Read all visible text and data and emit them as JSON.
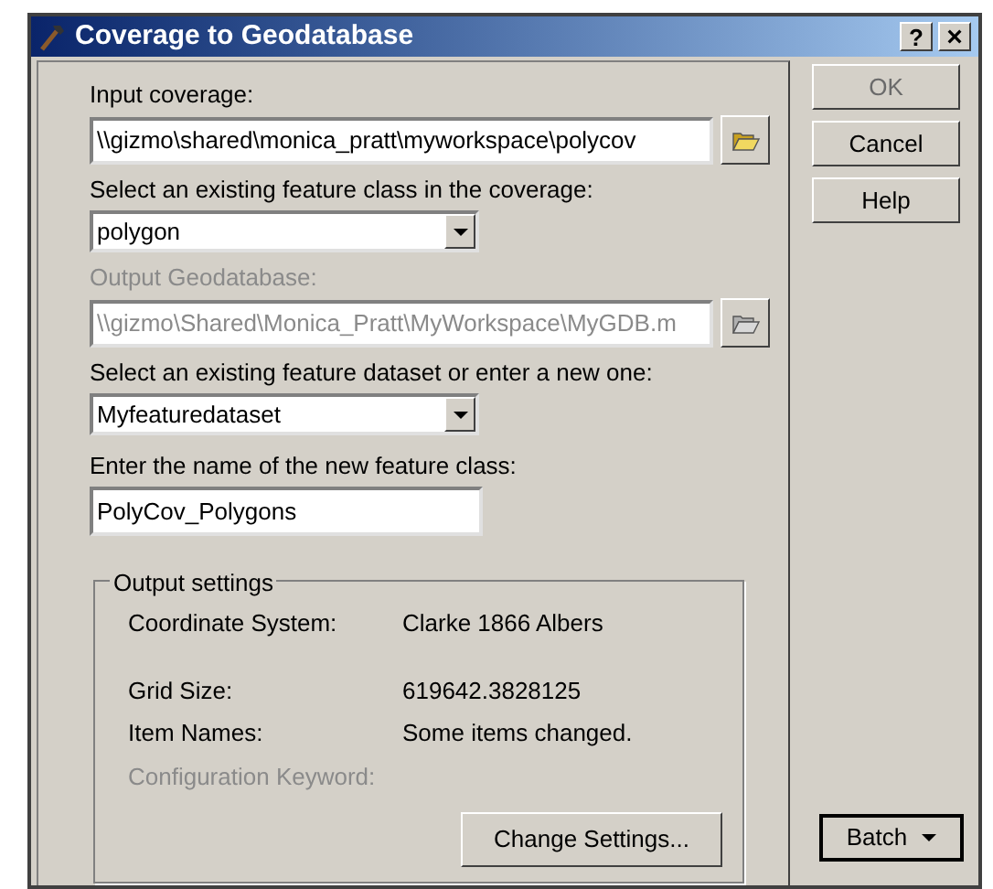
{
  "window": {
    "title": "Coverage to Geodatabase",
    "help_glyph": "?",
    "close_glyph": "×"
  },
  "fields": [
    {
      "kind": "browse",
      "label": "Input coverage:",
      "value": "\\\\gizmo\\shared\\monica_pratt\\myworkspace\\polycov",
      "disabled": false
    },
    {
      "kind": "combo",
      "label": "Select an existing feature class in the coverage:",
      "value": "polygon",
      "disabled": false
    },
    {
      "kind": "browse",
      "label": "Output Geodatabase:",
      "value": "\\\\gizmo\\Shared\\Monica_Pratt\\MyWorkspace\\MyGDB.m",
      "disabled": true
    },
    {
      "kind": "combo",
      "label": "Select an existing feature dataset or enter a new one:",
      "value": "Myfeaturedataset",
      "disabled": false
    },
    {
      "kind": "text",
      "label": "Enter the name of the new feature class:",
      "value": "PolyCov_Polygons",
      "disabled": false
    }
  ],
  "output_settings": {
    "title": "Output settings",
    "rows": [
      {
        "label": "Coordinate System:",
        "value": "Clarke 1866 Albers",
        "disabled": false
      },
      {
        "label": "Grid Size:",
        "value": "619642.3828125",
        "disabled": false
      },
      {
        "label": "Item Names:",
        "value": "Some items changed.",
        "disabled": false
      },
      {
        "label": "Configuration Keyword:",
        "disabled": true
      }
    ],
    "button": "Change Settings..."
  },
  "buttons": [
    {
      "kind": "plain",
      "label": "OK",
      "disabled": true
    },
    {
      "kind": "plain",
      "label": "Cancel",
      "disabled": false
    },
    {
      "kind": "plain",
      "label": "Help",
      "disabled": false
    }
  ],
  "batch_button": {
    "label": "Batch"
  }
}
